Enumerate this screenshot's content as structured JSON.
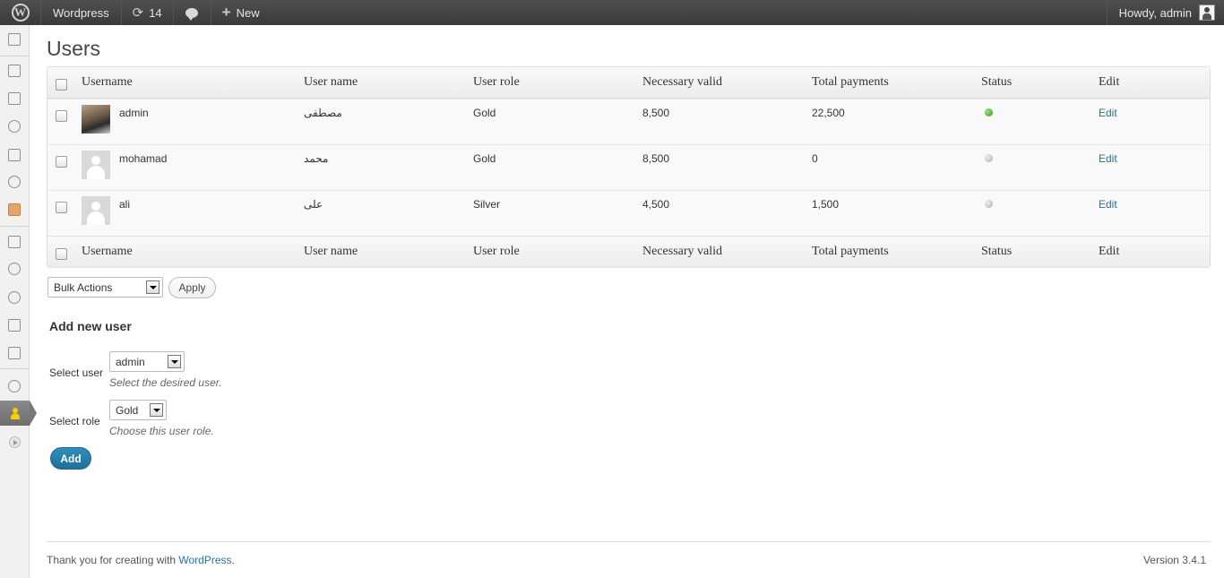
{
  "admin_bar": {
    "site_name": "Wordpress",
    "updates_count": "14",
    "new_label": "New",
    "greeting": "Howdy, admin"
  },
  "sidebar": {
    "icons": [
      "dashboard-icon",
      "posts-icon",
      "media-icon",
      "links-icon",
      "pages-icon",
      "comments-icon",
      "custom-icon",
      "appearance-icon",
      "plugins-icon",
      "users-icon",
      "tools-icon",
      "settings-icon",
      "gear-icon",
      "users-current-icon",
      "collapse-icon"
    ]
  },
  "page": {
    "title": "Users"
  },
  "table": {
    "columns": [
      "Username",
      "User name",
      "User role",
      "Necessary valid",
      "Total payments",
      "Status",
      "Edit"
    ],
    "rows": [
      {
        "username": "admin",
        "name": "مصطفى",
        "role": "Gold",
        "necessary": "8,500",
        "payments": "22,500",
        "status": "active",
        "edit": "Edit"
      },
      {
        "username": "mohamad",
        "name": "محمد",
        "role": "Gold",
        "necessary": "8,500",
        "payments": "0",
        "status": "inactive",
        "edit": "Edit"
      },
      {
        "username": "ali",
        "name": "على",
        "role": "Silver",
        "necessary": "4,500",
        "payments": "1,500",
        "status": "inactive",
        "edit": "Edit"
      }
    ]
  },
  "bulk": {
    "selected": "Bulk Actions",
    "apply_label": "Apply"
  },
  "add_user": {
    "title": "Add new user",
    "select_user_label": "Select user",
    "select_user_value": "admin",
    "select_user_hint": "Select the desired user.",
    "select_role_label": "Select role",
    "select_role_value": "Gold",
    "select_role_hint": "Choose this user role.",
    "add_label": "Add"
  },
  "footer": {
    "thanks_prefix": "Thank you for creating with ",
    "wordpress_link": "WordPress",
    "thanks_suffix": ".",
    "version": "Version 3.4.1"
  },
  "colors": {
    "link": "#21759b",
    "status_active": "#2c9e15",
    "status_inactive": "#aaaaaa",
    "primary_button": "#21759b"
  }
}
